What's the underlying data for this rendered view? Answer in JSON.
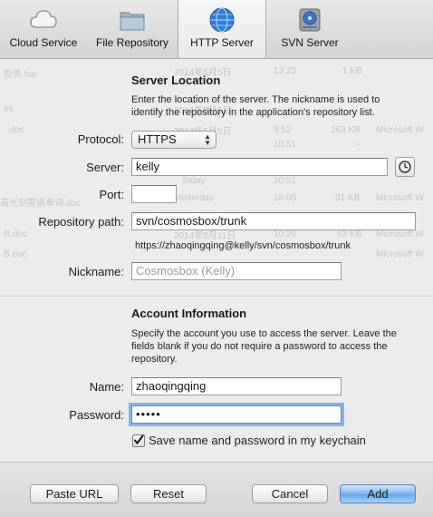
{
  "tabs": [
    {
      "label": "Cloud Service",
      "icon": "cloud-icon"
    },
    {
      "label": "File Repository",
      "icon": "folder-icon"
    },
    {
      "label": "HTTP Server",
      "icon": "globe-icon",
      "selected": true
    },
    {
      "label": "SVN Server",
      "icon": "hard-drive-icon"
    }
  ],
  "background_listing": [
    {
      "name": "投资.bar",
      "date": "2014年5月5日",
      "time": "13:23",
      "size": "1 KB",
      "kind": ""
    },
    {
      "name": "es",
      "date": "2014年5月5日",
      "time": "",
      "size": "",
      "kind": ""
    },
    {
      "name": ".doc",
      "date": "2014年5月5日",
      "time": "9:52",
      "size": "263 KB",
      "kind": "Microsoft W"
    },
    {
      "name": "",
      "date": "",
      "time": "10:51",
      "size": "--",
      "kind": ""
    },
    {
      "name": "",
      "date": "Today",
      "time": "10:51",
      "size": "",
      "kind": ""
    },
    {
      "name": "高光刻英语单词.doc",
      "date": "Yesterday",
      "time": "18:05",
      "size": "31 KB",
      "kind": "Microsoft W"
    },
    {
      "name": "R.doc",
      "date": "2014年5月11日",
      "time": "10:20",
      "size": "63 KB",
      "kind": "Microsoft W"
    },
    {
      "name": "B.doc",
      "date": "",
      "time": "",
      "size": "",
      "kind": "Microsoft W"
    }
  ],
  "server_location": {
    "title": "Server Location",
    "description": "Enter the location of the server. The nickname is used to identify the repository in the application's repository list.",
    "protocol_label": "Protocol:",
    "protocol_value": "HTTPS",
    "server_label": "Server:",
    "server_value": "kelly",
    "port_label": "Port:",
    "port_value": "",
    "repo_label": "Repository path:",
    "repo_value": "svn/cosmosbox/trunk",
    "url_preview": "https://zhaoqingqing@kelly/svn/cosmosbox/trunk",
    "nickname_label": "Nickname:",
    "nickname_placeholder": "Cosmosbox (Kelly)"
  },
  "account": {
    "title": "Account Information",
    "description": "Specify the account you use to access the server. Leave the fields blank if you do not require a password to access the repository.",
    "name_label": "Name:",
    "name_value": "zhaoqingqing",
    "password_label": "Password:",
    "password_value": "•••••",
    "keychain_label": "Save name and password in my keychain",
    "keychain_checked": true
  },
  "buttons": {
    "paste_url": "Paste URL",
    "reset": "Reset",
    "cancel": "Cancel",
    "add": "Add"
  },
  "colors": {
    "default_button": "#63a4ea",
    "focus_ring": "#86b3e6"
  }
}
